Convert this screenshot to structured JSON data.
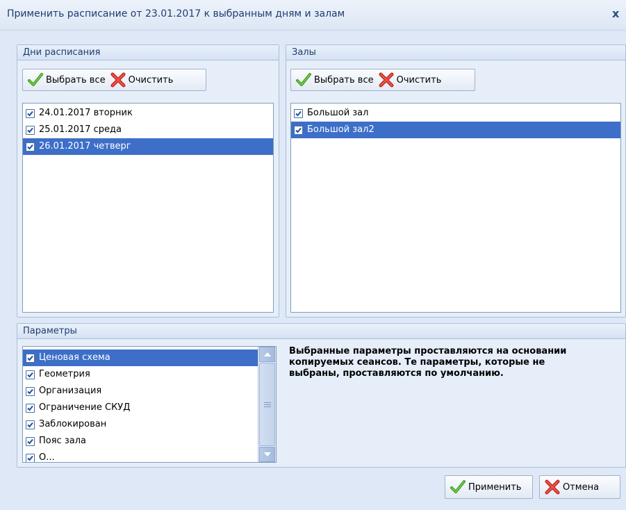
{
  "window": {
    "title": "Применить расписание от 23.01.2017 к выбранным дням и залам",
    "close_label": "x"
  },
  "days": {
    "header": "Дни расписания",
    "select_all_label": "Выбрать все",
    "clear_label": "Очистить",
    "items": [
      {
        "label": "24.01.2017 вторник",
        "checked": true,
        "selected": false
      },
      {
        "label": "25.01.2017 среда",
        "checked": true,
        "selected": false
      },
      {
        "label": "26.01.2017 четверг",
        "checked": true,
        "selected": true
      }
    ]
  },
  "halls": {
    "header": "Залы",
    "select_all_label": "Выбрать все",
    "clear_label": "Очистить",
    "items": [
      {
        "label": "Большой зал",
        "checked": true,
        "selected": false
      },
      {
        "label": "Большой зал2",
        "checked": true,
        "selected": true
      }
    ]
  },
  "params": {
    "header": "Параметры",
    "items": [
      {
        "label": "Ценовая схема",
        "checked": true,
        "selected": true
      },
      {
        "label": "Геометрия",
        "checked": true,
        "selected": false
      },
      {
        "label": "Организация",
        "checked": true,
        "selected": false
      },
      {
        "label": "Ограничение СКУД",
        "checked": true,
        "selected": false
      },
      {
        "label": "Заблокирован",
        "checked": true,
        "selected": false
      },
      {
        "label": "Пояс зала",
        "checked": true,
        "selected": false
      },
      {
        "label": "О...",
        "checked": true,
        "selected": false
      }
    ],
    "note": "Выбранные параметры проставляются на основании копируемых сеансов. Те параметры, которые не выбраны, проставляются по умолчанию."
  },
  "footer": {
    "apply_label": "Применить",
    "cancel_label": "Отмена"
  },
  "colors": {
    "selection": "#3d6fc9",
    "background": "#dfe8f6",
    "title_text": "#1f3c6e"
  }
}
